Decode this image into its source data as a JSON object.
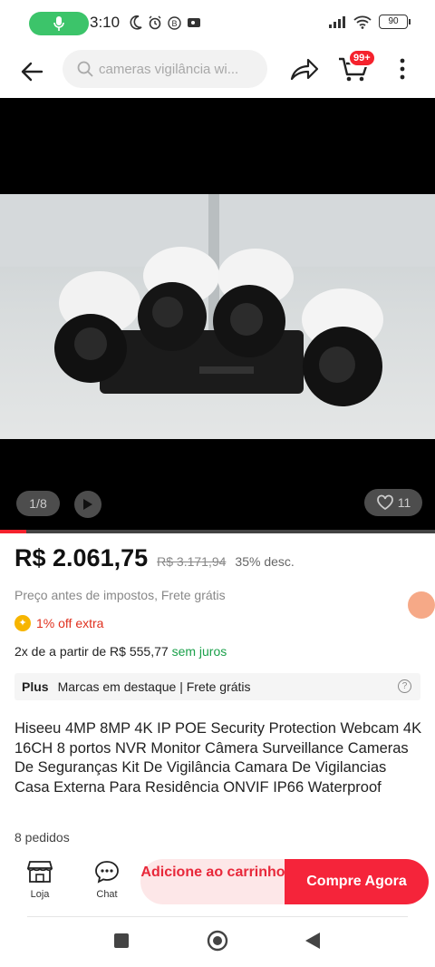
{
  "status_bar": {
    "time": "3:10",
    "battery": "90"
  },
  "search": {
    "placeholder": "cameras vigilância wi..."
  },
  "cart": {
    "badge": "99+"
  },
  "gallery": {
    "counter": "1/8",
    "likes": "11",
    "progress": 0.06
  },
  "price": {
    "current": "R$ 2.061,75",
    "original": "R$ 3.171,94",
    "discount": "35% desc.",
    "tax_note": "Preço antes de impostos, Frete grátis",
    "extra_off": "1% off extra",
    "installments_prefix": "2x de a partir de R$ 555,77",
    "installments_suffix": "sem juros"
  },
  "plus": {
    "label": "Plus",
    "text": "Marcas em destaque | Frete grátis"
  },
  "product": {
    "title": "Hiseeu 4MP 8MP 4K IP POE Security Protection Webcam 4K 16CH 8 portos NVR Monitor Câmera Surveillance Cameras De Seguranças Kit De Vigilância Camara De Vigilancias Casa Externa Para Residência ONVIF IP66 Waterproof",
    "orders": "8 pedidos"
  },
  "bottom_bar": {
    "store_label": "Loja",
    "chat_label": "Chat",
    "add_to_cart": "Adicione ao carrinho",
    "buy_now": "Compre Agora"
  },
  "colors": {
    "accent": "#f5243a",
    "green": "#1aa04a",
    "coin": "#f7b500"
  }
}
